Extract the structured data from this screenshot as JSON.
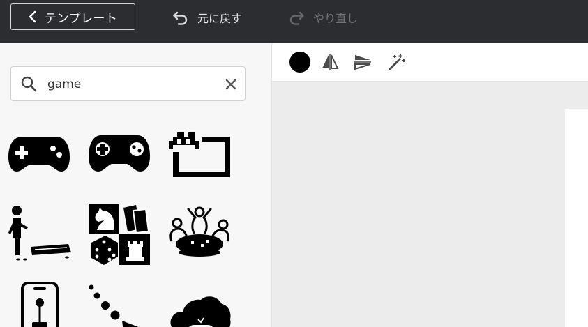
{
  "header": {
    "template_button": "テンプレート",
    "undo_label": "元に戻す",
    "redo_label": "やり直し"
  },
  "search": {
    "value": "game",
    "placeholder": ""
  },
  "results": [
    {
      "icon": "gamepad-icon"
    },
    {
      "icon": "game-controller-icon"
    },
    {
      "icon": "pixel-invader-frame-icon"
    },
    {
      "icon": "cornhole-player-icon"
    },
    {
      "icon": "board-games-icon"
    },
    {
      "icon": "people-around-table-icon"
    },
    {
      "icon": "phone-joystick-icon"
    },
    {
      "icon": "ball-trajectory-icon"
    },
    {
      "icon": "cloud-gaming-icon"
    }
  ],
  "toolbar": {
    "color": "#000000",
    "tools": [
      "color-swatch-icon",
      "flip-horizontal-icon",
      "flip-vertical-icon",
      "magic-wand-icon"
    ]
  }
}
